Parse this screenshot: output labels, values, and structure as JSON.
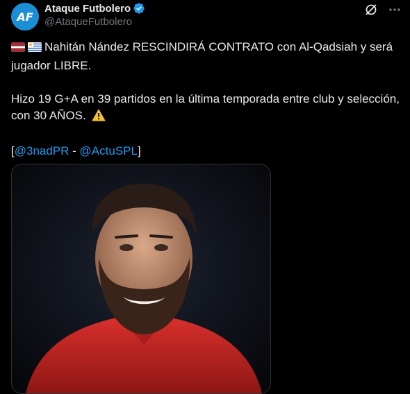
{
  "author": {
    "display_name": "Ataque Futbolero",
    "handle": "@AtaqueFutbolero",
    "avatar_text": "AF"
  },
  "tweet": {
    "line1_text": "Nahitán Nández RESCINDIRÁ CONTRATO con Al-Qadsiah y será jugador LIBRE.",
    "line2_text": "Hizo 19 G+A en 39 partidos en la última temporada entre club y selección, con 30 AÑOS.",
    "credit_open": "[",
    "credit_link1": "@3nadPR",
    "credit_sep": " - ",
    "credit_link2": "@ActuSPL",
    "credit_close": "]"
  },
  "icons": {
    "verified": "verified-badge-icon",
    "grok": "grok-icon",
    "more": "more-options-icon",
    "flag1": "latvia-flag-icon",
    "flag2": "uruguay-flag-icon",
    "warning": "warning-icon"
  },
  "colors": {
    "background": "#000000",
    "text": "#e7e9ea",
    "secondary": "#71767b",
    "link": "#1d9bf0"
  }
}
